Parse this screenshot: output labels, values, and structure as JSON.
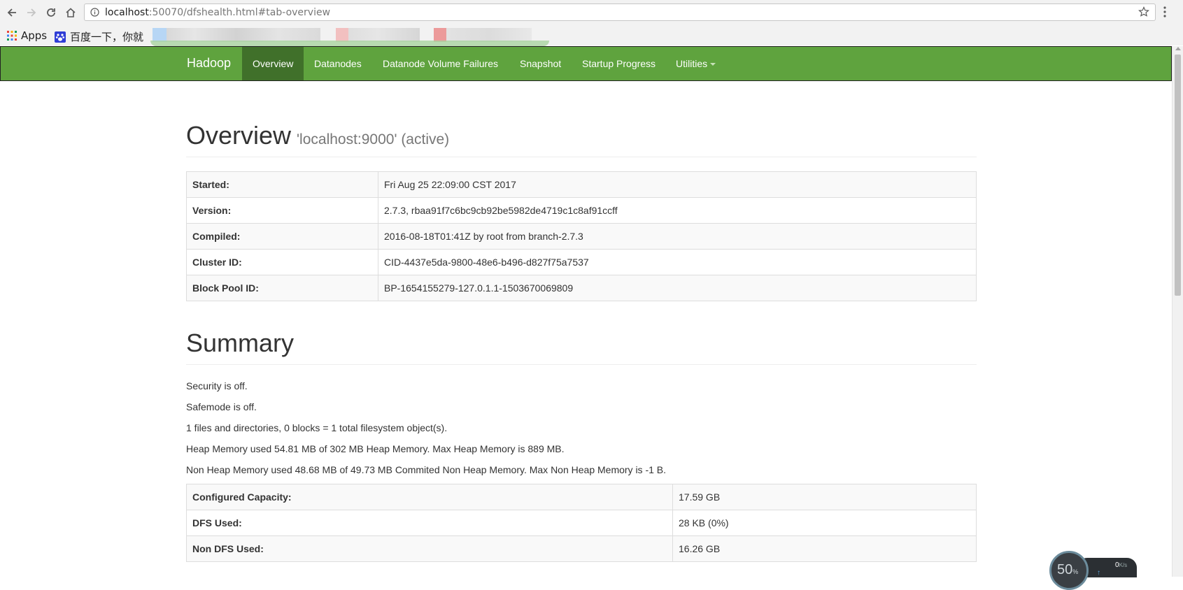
{
  "browser": {
    "url_host": "localhost",
    "url_rest": ":50070/dfshealth.html#tab-overview",
    "bookmarks": {
      "apps_label": "Apps",
      "baidu_label": "百度一下，你就"
    }
  },
  "navbar": {
    "brand": "Hadoop",
    "items": [
      {
        "label": "Overview",
        "active": true
      },
      {
        "label": "Datanodes"
      },
      {
        "label": "Datanode Volume Failures"
      },
      {
        "label": "Snapshot"
      },
      {
        "label": "Startup Progress"
      },
      {
        "label": "Utilities"
      }
    ]
  },
  "overview": {
    "title": "Overview",
    "subtitle": "'localhost:9000' (active)",
    "rows": [
      {
        "label": "Started:",
        "value": "Fri Aug 25 22:09:00 CST 2017"
      },
      {
        "label": "Version:",
        "value": "2.7.3, rbaa91f7c6bc9cb92be5982de4719c1c8af91ccff"
      },
      {
        "label": "Compiled:",
        "value": "2016-08-18T01:41Z by root from branch-2.7.3"
      },
      {
        "label": "Cluster ID:",
        "value": "CID-4437e5da-9800-48e6-b496-d827f75a7537"
      },
      {
        "label": "Block Pool ID:",
        "value": "BP-1654155279-127.0.1.1-1503670069809"
      }
    ]
  },
  "summary": {
    "title": "Summary",
    "lines": [
      "Security is off.",
      "Safemode is off.",
      "1 files and directories, 0 blocks = 1 total filesystem object(s).",
      "Heap Memory used 54.81 MB of 302 MB Heap Memory. Max Heap Memory is 889 MB.",
      "Non Heap Memory used 48.68 MB of 49.73 MB Commited Non Heap Memory. Max Non Heap Memory is -1 B."
    ],
    "rows": [
      {
        "label": "Configured Capacity:",
        "value": "17.59 GB"
      },
      {
        "label": "DFS Used:",
        "value": "28 KB (0%)"
      },
      {
        "label": "Non DFS Used:",
        "value": "16.26 GB"
      }
    ]
  },
  "net_widget": {
    "percent": "50",
    "percent_unit": "%",
    "speed": "0",
    "speed_unit": "K/s"
  },
  "colors": {
    "navbar_bg": "#5fa33e",
    "navbar_active_bg": "#40702a"
  }
}
